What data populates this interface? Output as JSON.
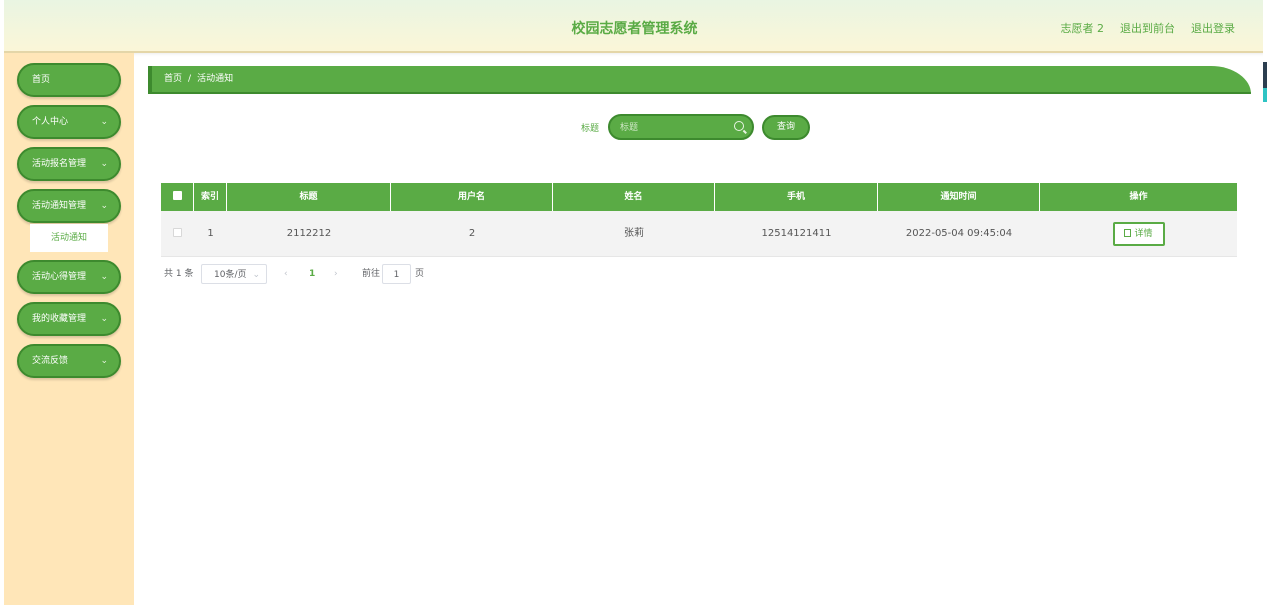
{
  "header": {
    "title": "校园志愿者管理系统",
    "user": "志愿者 2",
    "to_front": "退出到前台",
    "logout": "退出登录"
  },
  "sidebar": {
    "items": [
      {
        "label": "首页",
        "has_chevron": false
      },
      {
        "label": "个人中心",
        "has_chevron": true
      },
      {
        "label": "活动报名管理",
        "has_chevron": true
      },
      {
        "label": "活动通知管理",
        "has_chevron": true
      },
      {
        "label": "活动心得管理",
        "has_chevron": true
      },
      {
        "label": "我的收藏管理",
        "has_chevron": true
      },
      {
        "label": "交流反馈",
        "has_chevron": true
      }
    ],
    "submenu_active": "活动通知"
  },
  "breadcrumb": {
    "home": "首页",
    "separator": "/",
    "current": "活动通知"
  },
  "search": {
    "label": "标题",
    "placeholder": "标题",
    "button": "查询"
  },
  "table": {
    "columns": [
      "索引",
      "标题",
      "用户名",
      "姓名",
      "手机",
      "通知时间",
      "操作"
    ],
    "rows": [
      {
        "index": "1",
        "title": "2112212",
        "username": "2",
        "name": "张莉",
        "phone": "12514121411",
        "time": "2022-05-04 09:45:04",
        "action": "详情"
      }
    ]
  },
  "pagination": {
    "total": "共 1 条",
    "page_size": "10条/页",
    "current_page": "1",
    "goto_label": "前往",
    "goto_value": "1",
    "page_suffix": "页"
  },
  "colors": {
    "primary": "#5aab45",
    "primary_dark": "#3d8a2e",
    "sidebar_bg": "#ffe6b8"
  }
}
